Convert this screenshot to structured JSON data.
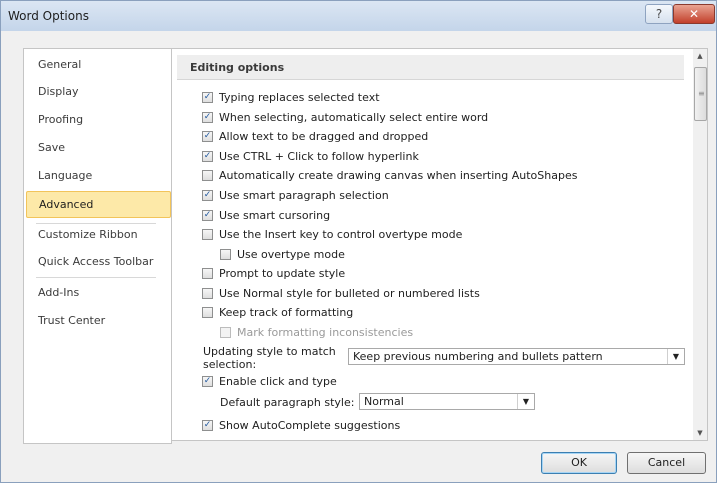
{
  "window": {
    "title": "Word Options",
    "help_glyph": "?",
    "close_glyph": "✕"
  },
  "nav": {
    "items": [
      {
        "label": "General"
      },
      {
        "label": "Display"
      },
      {
        "label": "Proofing"
      },
      {
        "label": "Save"
      },
      {
        "label": "Language"
      },
      {
        "label": "Advanced",
        "selected": true
      },
      {
        "label": "Customize Ribbon"
      },
      {
        "label": "Quick Access Toolbar"
      },
      {
        "label": "Add-Ins"
      },
      {
        "label": "Trust Center"
      }
    ]
  },
  "section": {
    "title": "Editing options"
  },
  "options": [
    {
      "label": "Typing replaces selected text",
      "checked": true
    },
    {
      "label": "When selecting, automatically select entire word",
      "checked": true
    },
    {
      "label": "Allow text to be dragged and dropped",
      "checked": true
    },
    {
      "label": "Use CTRL + Click to follow hyperlink",
      "checked": true
    },
    {
      "label": "Automatically create drawing canvas when inserting AutoShapes",
      "checked": false
    },
    {
      "label": "Use smart paragraph selection",
      "checked": true
    },
    {
      "label": "Use smart cursoring",
      "checked": true
    },
    {
      "label": "Use the Insert key to control overtype mode",
      "checked": false
    },
    {
      "label": "Use overtype mode",
      "checked": false
    },
    {
      "label": "Prompt to update style",
      "checked": false
    },
    {
      "label": "Use Normal style for bulleted or numbered lists",
      "checked": false
    },
    {
      "label": "Keep track of formatting",
      "checked": false
    },
    {
      "label": "Mark formatting inconsistencies",
      "checked": false,
      "disabled": true
    },
    {
      "label": "Enable click and type",
      "checked": true
    },
    {
      "label": "Show AutoComplete suggestions",
      "checked": true
    }
  ],
  "updating_style": {
    "label_line1": "Updating style to match",
    "label_line2": "selection:",
    "value": "Keep previous numbering and bullets pattern"
  },
  "default_paragraph_style": {
    "label": "Default paragraph style:",
    "value": "Normal"
  },
  "buttons": {
    "ok": "OK",
    "cancel": "Cancel"
  },
  "icons": {
    "checkmark": "✓",
    "dropdown": "▼",
    "scroll_up": "▲",
    "scroll_down": "▼",
    "thumb_grip": "≡"
  }
}
